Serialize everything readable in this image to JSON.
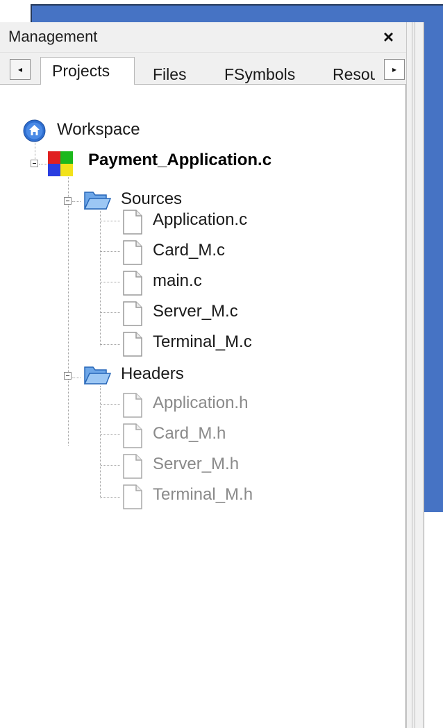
{
  "panel": {
    "title": "Management",
    "close_glyph": "×"
  },
  "tabs": [
    {
      "label": "Projects",
      "active": true
    },
    {
      "label": "Files",
      "active": false
    },
    {
      "label": "FSymbols",
      "active": false
    },
    {
      "label": "Resources",
      "active": false
    }
  ],
  "tab_scroll": {
    "left_glyph": "◂",
    "right_glyph": "▸"
  },
  "tree": {
    "workspace": {
      "label": "Workspace",
      "icon": "workspace-home-icon"
    },
    "project": {
      "label": "Payment_Application.c",
      "icon": "project-colored-squares-icon"
    },
    "folders": [
      {
        "label": "Sources",
        "icon": "folder-open-icon",
        "files": [
          "Application.c",
          "Card_M.c",
          "main.c",
          "Server_M.c",
          "Terminal_M.c"
        ],
        "file_color": "#1a1a1a"
      },
      {
        "label": "Headers",
        "icon": "folder-open-icon",
        "files": [
          "Application.h",
          "Card_M.h",
          "Server_M.h",
          "Terminal_M.h"
        ],
        "file_color": "#8a8a8a"
      }
    ]
  },
  "colors": {
    "background_blue": "#4673c4",
    "folder_blue": "#3b86d6",
    "workspace_blue": "#2f6fd0"
  }
}
